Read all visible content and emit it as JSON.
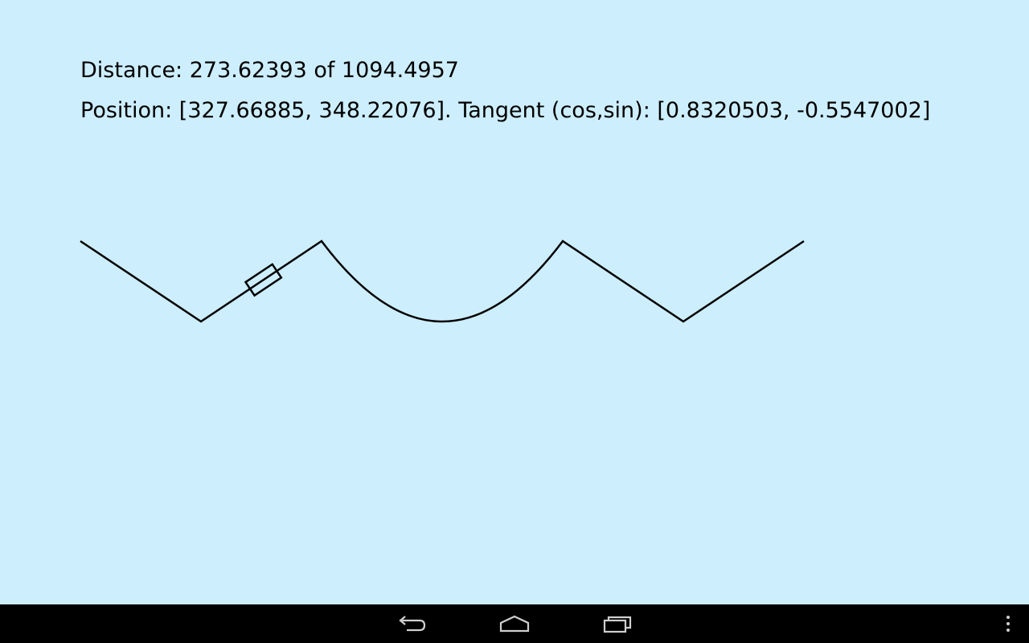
{
  "status": {
    "distance_line": "Distance: 273.62393 of 1094.4957",
    "position_line": "Position: [327.66885, 348.22076]. Tangent (cos,sin): [0.8320503, -0.5547002]"
  },
  "colors": {
    "background": "#cdeefd",
    "stroke": "#000000",
    "navbar": "#000000",
    "nav_icon": "#cfcfcf"
  },
  "navbar": {
    "buttons": [
      {
        "name": "back",
        "icon": "back-arrow-icon"
      },
      {
        "name": "home",
        "icon": "home-icon"
      },
      {
        "name": "recents",
        "icon": "recent-apps-icon"
      },
      {
        "name": "menu",
        "icon": "overflow-menu-icon"
      }
    ]
  }
}
